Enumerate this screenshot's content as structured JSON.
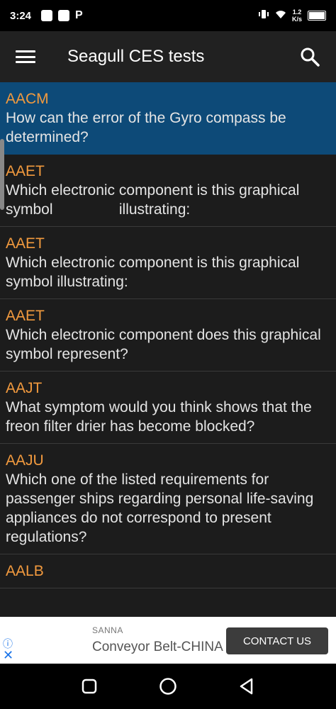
{
  "status_bar": {
    "time": "3:24",
    "speed_value": "1.2",
    "speed_unit": "K/s"
  },
  "app_bar": {
    "title": "Seagull CES tests",
    "menu_icon": "hamburger-menu-icon",
    "search_icon": "search-icon"
  },
  "list": {
    "items": [
      {
        "code": "AACM",
        "question": "How can the error of the Gyro compass be determined?",
        "selected": true
      },
      {
        "code": "AAET",
        "question": "Which electronic component is this graphical symbol                illustrating:"
      },
      {
        "code": "AAET",
        "question": "Which electronic component is this graphical symbol illustrating:"
      },
      {
        "code": "AAET",
        "question": "Which electronic component does this graphical symbol represent?"
      },
      {
        "code": "AAJT",
        "question": "What symptom would you think shows that the freon filter drier has become blocked?"
      },
      {
        "code": "AAJU",
        "question": "Which one of the listed requirements for passenger ships regarding personal life-saving appliances do not correspond to present regulations?"
      },
      {
        "code": "AALB",
        "question": ""
      }
    ]
  },
  "ad": {
    "brand": "SANNA",
    "text": "Conveyor Belt-CHINA",
    "cta": "CONTACT US",
    "info_icon": "info-icon",
    "close_icon": "close-icon"
  },
  "nav_bar": {
    "recents_icon": "square-recents-icon",
    "home_icon": "circle-home-icon",
    "back_icon": "triangle-back-icon"
  }
}
